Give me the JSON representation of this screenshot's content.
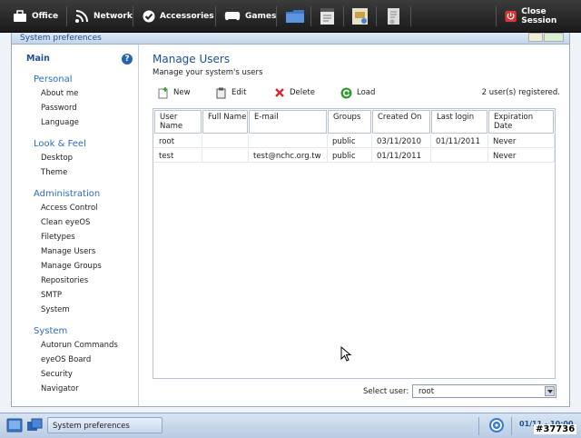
{
  "topbar": {
    "menus": [
      {
        "label": "Office",
        "icon": "office-bag-icon"
      },
      {
        "label": "Network",
        "icon": "network-signal-icon"
      },
      {
        "label": "Accessories",
        "icon": "accessories-check-icon"
      },
      {
        "label": "Games",
        "icon": "gamepad-icon"
      }
    ],
    "quick_icons": [
      "folder-icon",
      "text-editor-icon",
      "presentation-icon",
      "document-icon"
    ],
    "close_session": "Close Session"
  },
  "window": {
    "title": "System preferences"
  },
  "sidebar": {
    "main": "Main",
    "sections": [
      {
        "title": "Personal",
        "items": [
          "About me",
          "Password",
          "Language"
        ]
      },
      {
        "title": "Look & Feel",
        "items": [
          "Desktop",
          "Theme"
        ]
      },
      {
        "title": "Administration",
        "items": [
          "Access Control",
          "Clean eyeOS",
          "Filetypes",
          "Manage Users",
          "Manage Groups",
          "Repositories",
          "SMTP",
          "System"
        ]
      },
      {
        "title": "System",
        "items": [
          "Autorun Commands",
          "eyeOS Board",
          "Security",
          "Navigator"
        ]
      }
    ]
  },
  "content": {
    "title": "Manage Users",
    "subtitle": "Manage your system's users",
    "toolbar": {
      "new": "New",
      "edit": "Edit",
      "delete": "Delete",
      "load": "Load"
    },
    "registered": "2 user(s) registered.",
    "table": {
      "headers": [
        "User Name",
        "Full Name",
        "E-mail",
        "Groups",
        "Created On",
        "Last login",
        "Expiration Date"
      ],
      "rows": [
        [
          "root",
          "",
          "",
          "public",
          "03/11/2010",
          "01/11/2011",
          "Never"
        ],
        [
          "test",
          "",
          "test@nchc.org.tw",
          "public",
          "01/11/2011",
          "",
          "Never"
        ]
      ]
    },
    "select_user_label": "Select user:",
    "select_user_value": "root"
  },
  "taskbar": {
    "task_label": "System preferences",
    "clock": "01/11 - 10:00"
  },
  "stamp": "#37736",
  "colors": {
    "accent": "#1d4e93",
    "topbar": "#2a2a2a",
    "close": "#c0392b"
  }
}
